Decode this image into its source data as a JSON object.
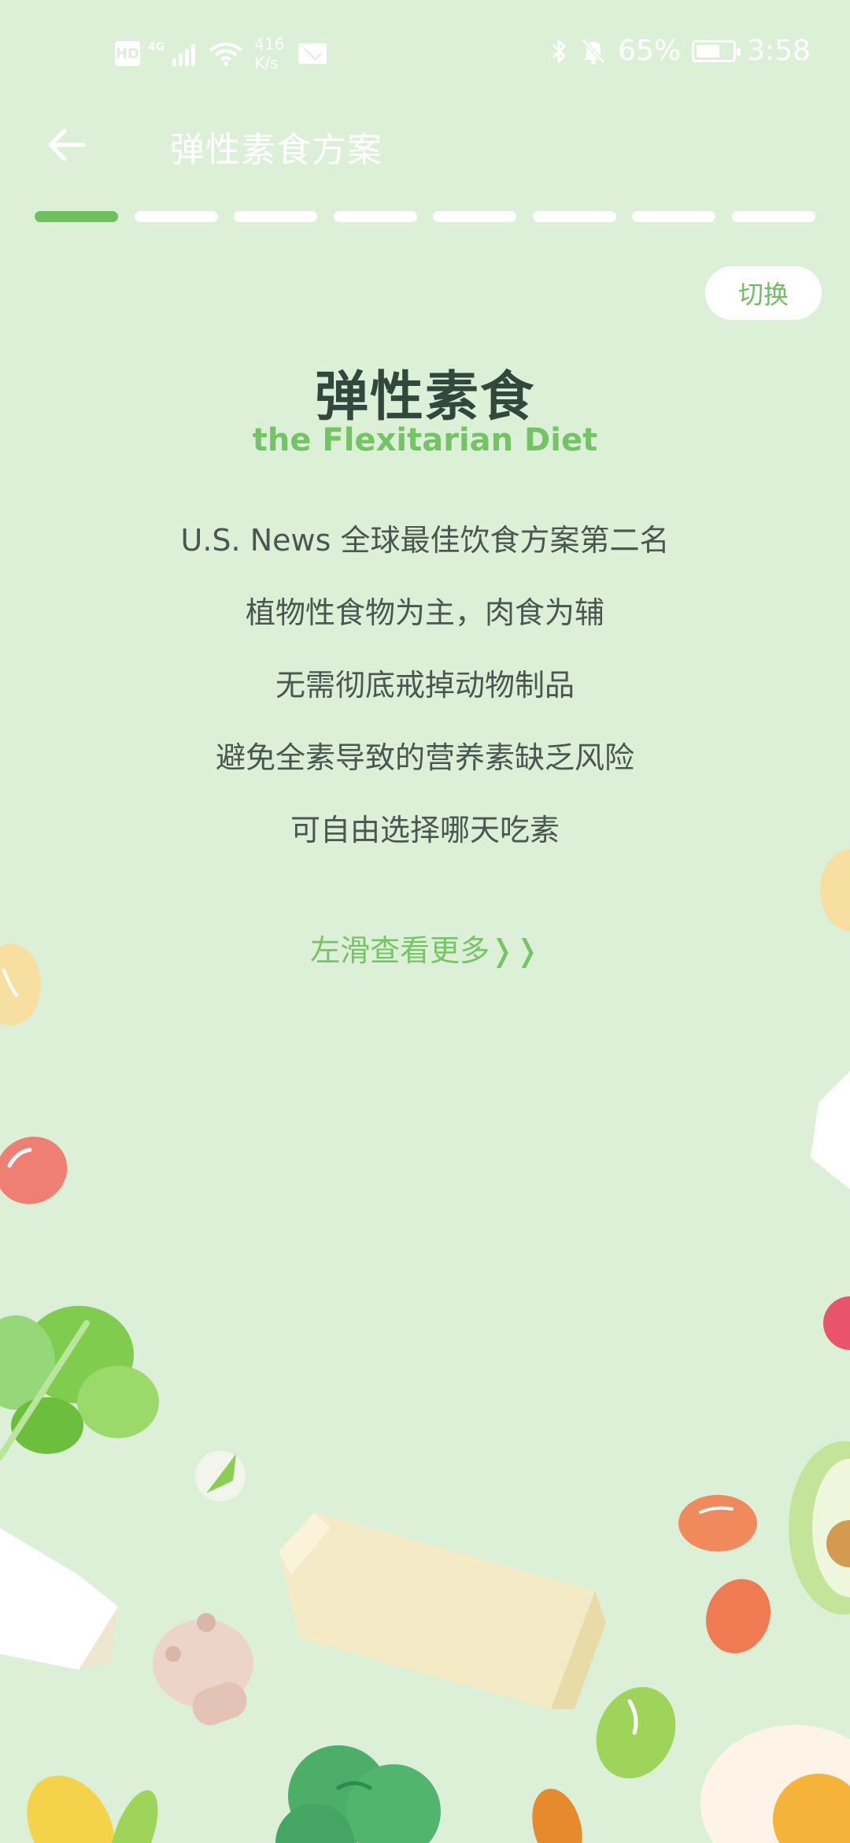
{
  "status_bar": {
    "hd_label": "HD",
    "network_label": "4G",
    "speed_value": "416",
    "speed_unit": "K/s",
    "battery_percent": "65%",
    "battery_level": 0.65,
    "time": "3:58"
  },
  "header": {
    "title": "弹性素食方案",
    "back_icon": "arrow-left-icon"
  },
  "progress": {
    "total_steps": 8,
    "current_step": 1
  },
  "switch_label": "切换",
  "diet": {
    "title": "弹性素食",
    "subtitle": "the Flexitarian Diet",
    "features": [
      "U.S. News 全球最佳饮食方案第二名",
      "植物性食物为主，肉食为辅",
      "无需彻底戒掉动物制品",
      "避免全素导致的营养素缺乏风险",
      "可自由选择哪天吃素"
    ],
    "swipe_hint": "左滑查看更多❭❭"
  },
  "colors": {
    "background": "#dcf0d8",
    "accent": "#6fc05f",
    "title_text": "#33473d"
  }
}
